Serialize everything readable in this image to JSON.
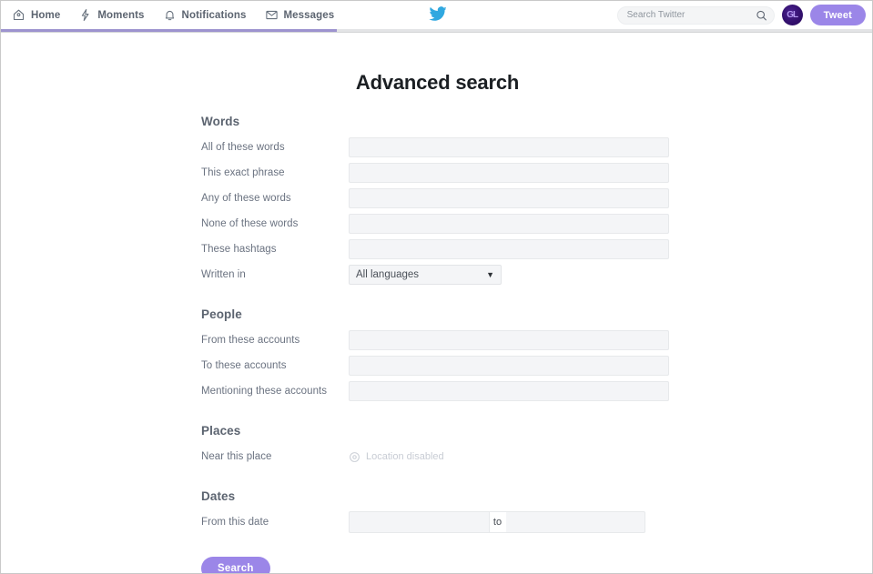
{
  "navbar": {
    "items": [
      {
        "label": "Home",
        "icon": "home-icon"
      },
      {
        "label": "Moments",
        "icon": "lightning-icon"
      },
      {
        "label": "Notifications",
        "icon": "bell-icon"
      },
      {
        "label": "Messages",
        "icon": "envelope-icon"
      }
    ],
    "logo_icon": "twitter-bird-icon",
    "search": {
      "placeholder": "Search Twitter",
      "value": "",
      "icon": "search-icon"
    },
    "avatar": {
      "icon": "user-avatar",
      "initials": "GL"
    },
    "tweet_button": "Tweet"
  },
  "page": {
    "title": "Advanced search"
  },
  "sections": {
    "words": {
      "heading": "Words",
      "fields": [
        {
          "label": "All of these words",
          "value": "",
          "placeholder": ""
        },
        {
          "label": "This exact phrase",
          "value": "",
          "placeholder": ""
        },
        {
          "label": "Any of these words",
          "value": "",
          "placeholder": ""
        },
        {
          "label": "None of these words",
          "value": "",
          "placeholder": ""
        },
        {
          "label": "These hashtags",
          "value": "",
          "placeholder": ""
        }
      ],
      "language": {
        "label": "Written in",
        "selected": "All languages",
        "caret_icon": "chevron-down-icon"
      }
    },
    "people": {
      "heading": "People",
      "fields": [
        {
          "label": "From these accounts",
          "value": "",
          "placeholder": ""
        },
        {
          "label": "To these accounts",
          "value": "",
          "placeholder": ""
        },
        {
          "label": "Mentioning these accounts",
          "value": "",
          "placeholder": ""
        }
      ]
    },
    "places": {
      "heading": "Places",
      "label": "Near this place",
      "status": "Location disabled",
      "icon": "location-pin-icon"
    },
    "dates": {
      "heading": "Dates",
      "label": "From this date",
      "from_value": "",
      "separator": "to",
      "to_value": ""
    }
  },
  "submit": {
    "label": "Search"
  },
  "colors": {
    "accent_purple": "#9b86e8",
    "progress_bar": "#9d93cf",
    "twitter_blue": "#30a8e0",
    "label_gray": "#6a7280",
    "field_bg": "#f4f5f7"
  }
}
